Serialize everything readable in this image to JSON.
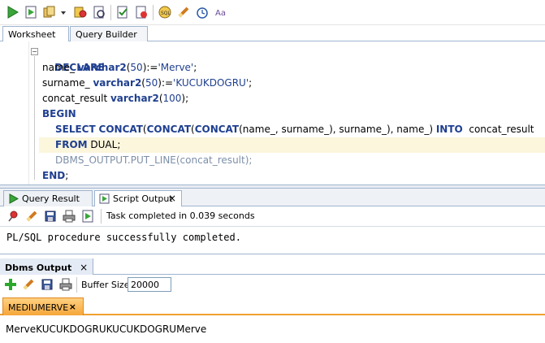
{
  "toolbar": {
    "icons": [
      "run-statement-icon",
      "run-script-icon",
      "explain-plan-icon",
      "autotrace-icon",
      "sql-tuning-icon",
      "commit-icon",
      "rollback-icon",
      "sql-history-icon",
      "clear-icon",
      "history-clock-icon",
      "to-upper-lower-icon"
    ]
  },
  "tabs": {
    "worksheet": "Worksheet",
    "query_builder": "Query Builder"
  },
  "code": {
    "l1_kw": "DECLARE",
    "l2_a": "name_ ",
    "l2_kw": "varchar2",
    "l2_b": "(",
    "l2_num": "50",
    "l2_c": "):=",
    "l2_str": "'Merve'",
    "l2_d": ";",
    "l3_a": "surname_ ",
    "l3_kw": "varchar2",
    "l3_b": "(",
    "l3_num": "50",
    "l3_c": "):=",
    "l3_str": "'KUCUKDOGRU'",
    "l3_d": ";",
    "l4_a": "concat_result ",
    "l4_kw": "varchar2",
    "l4_b": "(",
    "l4_num": "100",
    "l4_c": ");",
    "l5_kw": "BEGIN",
    "l6_kw1": "SELECT",
    "l6_kw2": "CONCAT",
    "l6_a": "(",
    "l6_kw3": "CONCAT",
    "l6_b": "(",
    "l6_kw4": "CONCAT",
    "l6_c": "(name_, surname_), surname_), name_) ",
    "l6_kw5": "INTO",
    "l6_d": "  concat_result",
    "l7_kw": "FROM",
    "l7_a": " DUAL;",
    "l8_grey": "DBMS_OUTPUT.PUT_LINE(concat_result);",
    "l9_kw": "END",
    "l9_a": ";"
  },
  "results": {
    "tab_query_result": "Query Result",
    "tab_script_output": "Script Output",
    "close_glyph": "×",
    "status": "Task completed in 0.039 seconds",
    "output": "PL/SQL procedure successfully completed."
  },
  "dbms": {
    "title": "Dbms Output",
    "close_glyph": "×",
    "buffer_label": "Buffer Size:",
    "buffer_value": "20000",
    "connection_tab": "MEDIUMERVE",
    "connection_close": "×",
    "output_text": "MerveKUCUKDOGRUKUCUKDOGRUMerve"
  }
}
